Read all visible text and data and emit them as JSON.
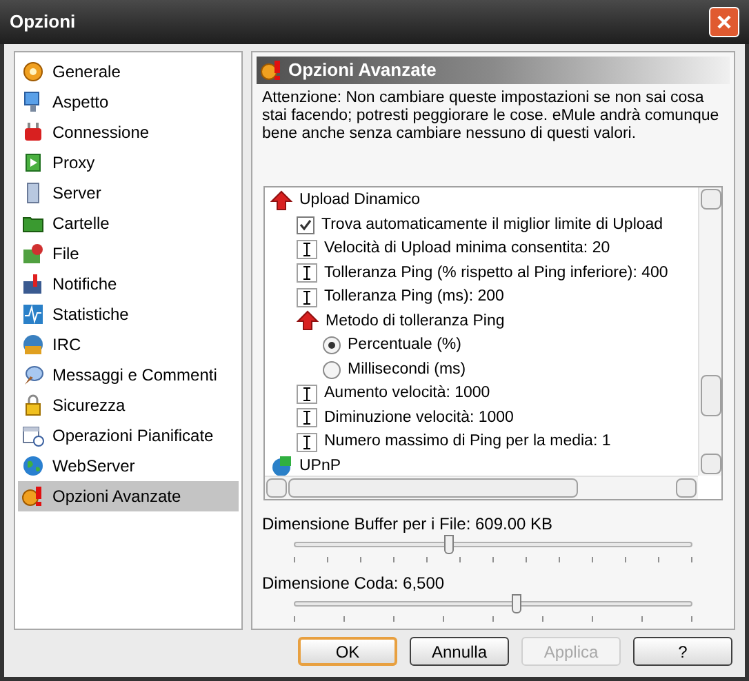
{
  "window": {
    "title": "Opzioni"
  },
  "sidebar": {
    "items": [
      {
        "label": "Generale",
        "selected": false
      },
      {
        "label": "Aspetto",
        "selected": false
      },
      {
        "label": "Connessione",
        "selected": false
      },
      {
        "label": "Proxy",
        "selected": false
      },
      {
        "label": "Server",
        "selected": false
      },
      {
        "label": "Cartelle",
        "selected": false
      },
      {
        "label": "File",
        "selected": false
      },
      {
        "label": "Notifiche",
        "selected": false
      },
      {
        "label": "Statistiche",
        "selected": false
      },
      {
        "label": "IRC",
        "selected": false
      },
      {
        "label": "Messaggi e Commenti",
        "selected": false
      },
      {
        "label": "Sicurezza",
        "selected": false
      },
      {
        "label": "Operazioni Pianificate",
        "selected": false
      },
      {
        "label": "WebServer",
        "selected": false
      },
      {
        "label": "Opzioni Avanzate",
        "selected": true
      }
    ]
  },
  "panel": {
    "title": "Opzioni Avanzate",
    "warning": "Attenzione: Non cambiare queste impostazioni se non sai cosa stai facendo; potresti peggiorare le cose. eMule andrà comunque bene anche senza cambiare nessuno di questi valori.",
    "tree": [
      {
        "kind": "group",
        "label": "Upload Dinamico",
        "children": [
          {
            "kind": "checkbox",
            "label": "Trova automaticamente il miglior limite di Upload",
            "checked": true
          },
          {
            "kind": "edit",
            "label": "Velocità di Upload minima consentita: 20"
          },
          {
            "kind": "edit",
            "label": "Tolleranza Ping (% rispetto al Ping inferiore): 400"
          },
          {
            "kind": "edit",
            "label": "Tolleranza Ping (ms): 200"
          },
          {
            "kind": "group",
            "label": "Metodo di tolleranza Ping",
            "children": [
              {
                "kind": "radio",
                "label": "Percentuale (%)",
                "selected": true
              },
              {
                "kind": "radio",
                "label": "Millisecondi (ms)",
                "selected": false
              }
            ]
          },
          {
            "kind": "edit",
            "label": "Aumento velocità: 1000"
          },
          {
            "kind": "edit",
            "label": "Diminuzione velocità: 1000"
          },
          {
            "kind": "edit",
            "label": "Numero massimo di Ping per la media: 1"
          }
        ]
      },
      {
        "kind": "network",
        "label": "UPnP"
      }
    ],
    "sliders": [
      {
        "label": "Dimensione Buffer per i File: 609.00 KB",
        "level": 0.39
      },
      {
        "label": "Dimensione Coda: 6,500",
        "level": 0.56
      }
    ]
  },
  "buttons": [
    {
      "label": "OK",
      "default": true,
      "disabled": false
    },
    {
      "label": "Annulla",
      "default": false,
      "disabled": false
    },
    {
      "label": "Applica",
      "default": false,
      "disabled": true
    },
    {
      "label": "?",
      "default": false,
      "disabled": false
    }
  ]
}
